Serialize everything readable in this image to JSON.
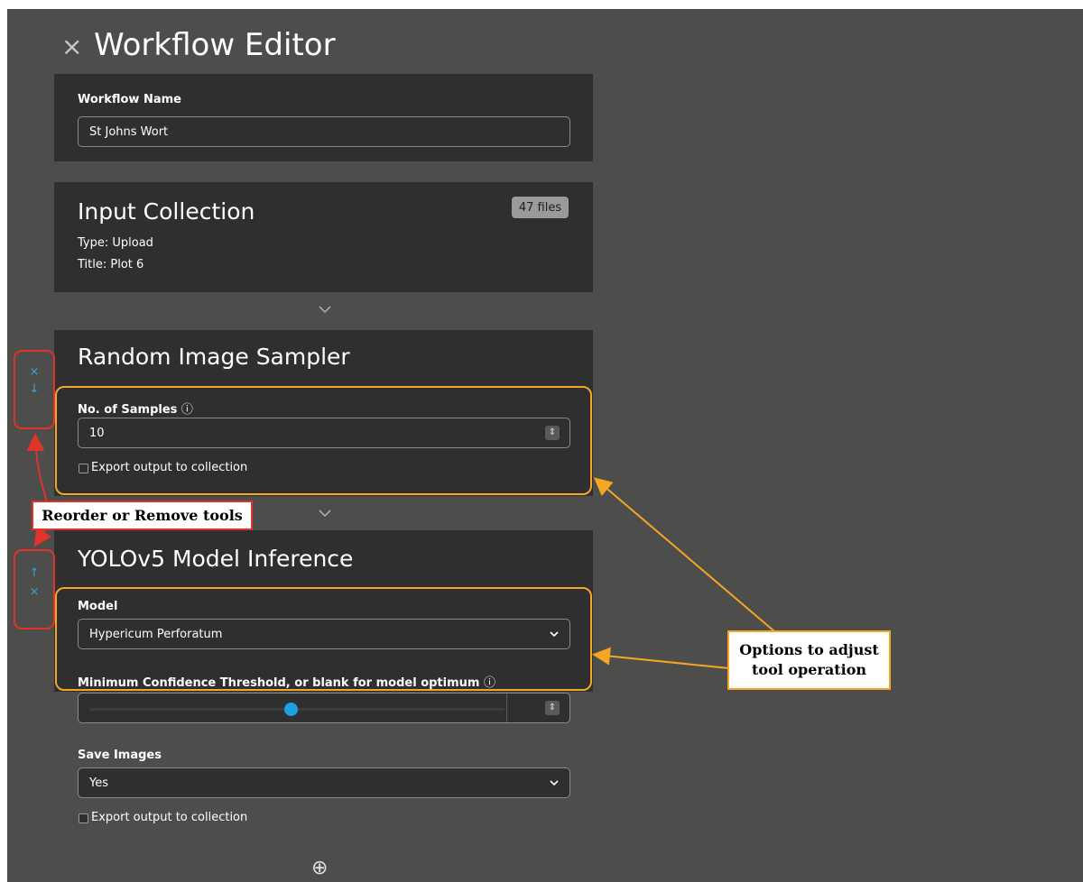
{
  "editor": {
    "close_icon": "×",
    "title": "Workflow Editor",
    "workflow_name_label": "Workflow Name",
    "workflow_name_value": "St Johns Wort",
    "add_icon": "⊕"
  },
  "input_collection": {
    "title": "Input Collection",
    "badge": "47 files",
    "type_line": "Type: Upload",
    "title_line": "Title: Plot 6"
  },
  "random_sampler": {
    "title": "Random Image Sampler",
    "samples_label": "No. of Samples",
    "info_icon": "ⓘ",
    "samples_value": "10",
    "export_label": "Export output to collection"
  },
  "yolo": {
    "title": "YOLOv5 Model Inference",
    "model_label": "Model",
    "model_value": "Hypericum Perforatum",
    "threshold_label": "Minimum Confidence Threshold, or blank for model optimum",
    "threshold_fraction": 0.5,
    "save_images_label": "Save Images",
    "save_images_value": "Yes",
    "export_label": "Export output to collection"
  },
  "reorder_controls": {
    "group1": [
      "×",
      "↓"
    ],
    "group2": [
      "↑",
      "×"
    ]
  },
  "annotations": {
    "reorder_text": "Reorder or Remove tools",
    "options_text_line1": "Options to adjust",
    "options_text_line2": "tool operation"
  },
  "colors": {
    "background": "#4d4d4b",
    "card": "#2f2f2f",
    "accent_blue": "#1ea0e6",
    "annotation_orange": "#f5a623",
    "annotation_red": "#e0332c"
  }
}
